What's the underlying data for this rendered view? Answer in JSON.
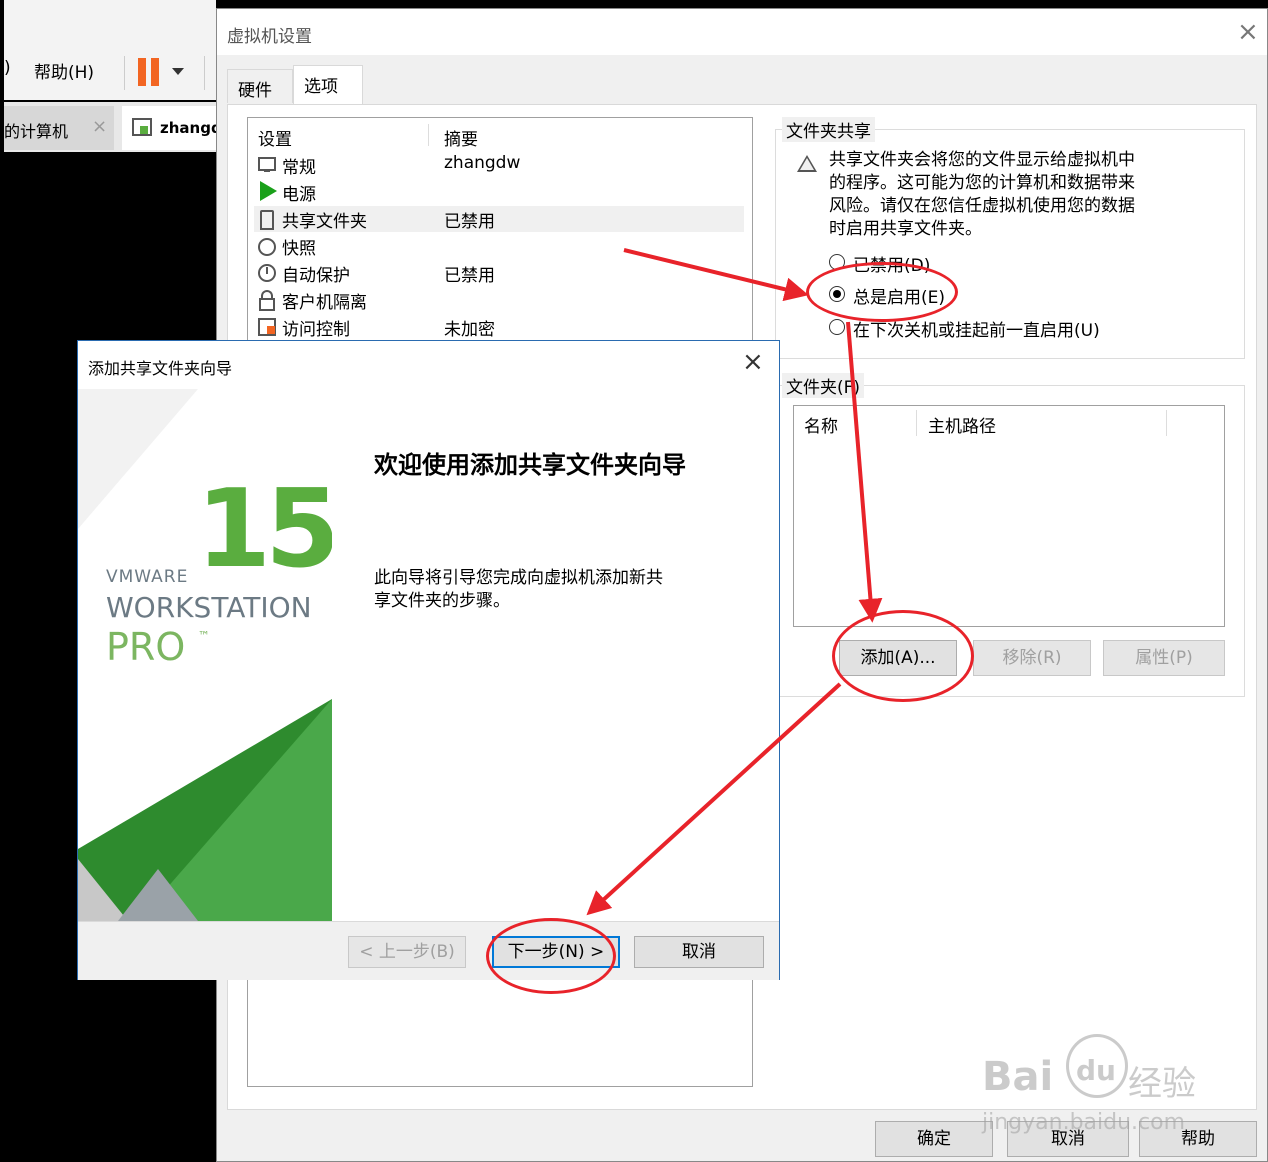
{
  "background_app": {
    "menu_fragment": ")",
    "menu_help": "帮助(H)",
    "tab_computer": "的计算机",
    "tab_vm": "zhangd",
    "tab_close": "×"
  },
  "settings_dialog": {
    "title": "虚拟机设置",
    "close": "×",
    "tabs": [
      {
        "label": "硬件"
      },
      {
        "label": "选项"
      }
    ],
    "list_headers": {
      "setting": "设置",
      "summary": "摘要"
    },
    "items": [
      {
        "name": "常规",
        "summary": "zhangdw",
        "icon": "monitor-icon"
      },
      {
        "name": "电源",
        "summary": "",
        "icon": "play-icon"
      },
      {
        "name": "共享文件夹",
        "summary": "已禁用",
        "icon": "shared-folder-icon"
      },
      {
        "name": "快照",
        "summary": "",
        "icon": "snapshot-icon"
      },
      {
        "name": "自动保护",
        "summary": "已禁用",
        "icon": "clock-icon"
      },
      {
        "name": "客户机隔离",
        "summary": "",
        "icon": "lock-icon"
      },
      {
        "name": "访问控制",
        "summary": "未加密",
        "icon": "access-control-icon"
      }
    ],
    "folder_sharing": {
      "group_label": "文件夹共享",
      "warning_lines": [
        "共享文件夹会将您的文件显示给虚拟机中",
        "的程序。这可能为您的计算机和数据带来",
        "风险。请仅在您信任虚拟机使用您的数据",
        "时启用共享文件夹。"
      ],
      "options": [
        {
          "label": "已禁用(D)",
          "selected": false
        },
        {
          "label": "总是启用(E)",
          "selected": true
        },
        {
          "label": "在下次关机或挂起前一直启用(U)",
          "selected": false
        }
      ]
    },
    "folders": {
      "group_label": "文件夹(F)",
      "columns": [
        "名称",
        "主机路径"
      ],
      "add": "添加(A)...",
      "remove": "移除(R)",
      "properties": "属性(P)"
    },
    "footer": {
      "ok": "确定",
      "cancel": "取消",
      "help": "帮助"
    }
  },
  "wizard": {
    "title": "添加共享文件夹向导",
    "close": "×",
    "heading": "欢迎使用添加共享文件夹向导",
    "body_lines": [
      "此向导将引导您完成向虚拟机添加新共",
      "享文件夹的步骤。"
    ],
    "brand": {
      "version": "15",
      "vmware": "VMWARE",
      "product": "WORKSTATION",
      "edition": "PRO",
      "tm": "™"
    },
    "back": "< 上一步(B)",
    "next": "下一步(N) >",
    "cancel": "取消"
  },
  "watermark": {
    "brand": "Bai",
    "brand_paw": "du",
    "brand_suffix": "经验",
    "url": "jingyan.baidu.com"
  },
  "colors": {
    "annotation_red": "#e8232a",
    "vmware_green": "#5aad3f",
    "pause_orange": "#f26522"
  }
}
